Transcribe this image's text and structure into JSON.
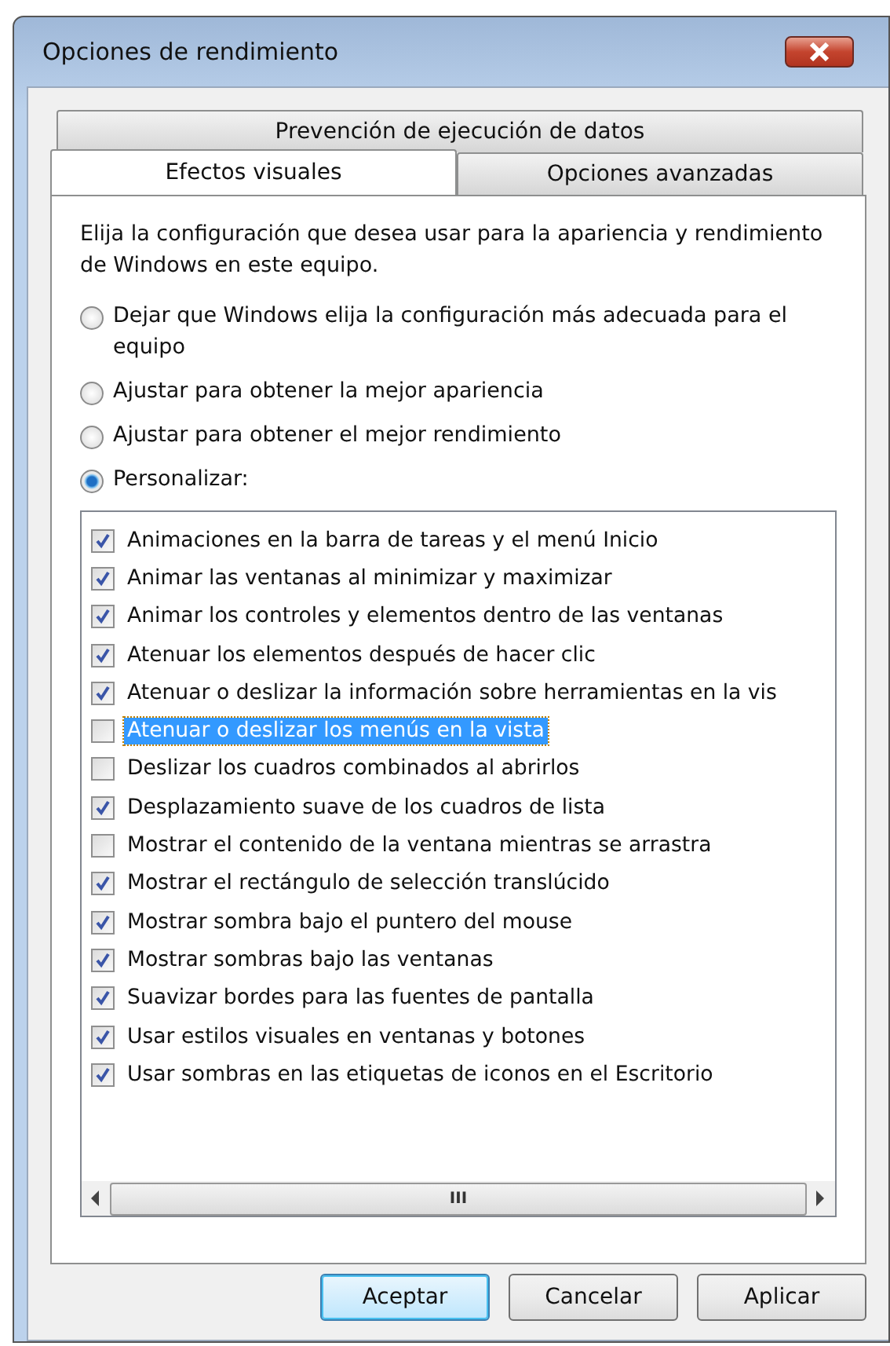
{
  "window": {
    "title": "Opciones de rendimiento"
  },
  "tabs_back": [
    {
      "label": "Prevención de ejecución de datos",
      "selected": false
    }
  ],
  "tabs_front": [
    {
      "label": "Efectos visuales",
      "selected": true
    },
    {
      "label": "Opciones avanzadas",
      "selected": false
    }
  ],
  "intro": "Elija la configuración que desea usar para la apariencia y rendimiento de Windows en este equipo.",
  "options": [
    {
      "label": "Dejar que Windows elija la configuración más adecuada para el equipo",
      "selected": false
    },
    {
      "label": "Ajustar para obtener la mejor apariencia",
      "selected": false
    },
    {
      "label": "Ajustar para obtener el mejor rendimiento",
      "selected": false
    },
    {
      "label": "Personalizar:",
      "selected": true
    }
  ],
  "effects": [
    {
      "label": "Animaciones en la barra de tareas y el menú Inicio",
      "checked": true,
      "selected": false
    },
    {
      "label": "Animar las ventanas al minimizar y maximizar",
      "checked": true,
      "selected": false
    },
    {
      "label": "Animar los controles y elementos dentro de las ventanas",
      "checked": true,
      "selected": false
    },
    {
      "label": "Atenuar los elementos después de hacer clic",
      "checked": true,
      "selected": false
    },
    {
      "label": "Atenuar o deslizar la información sobre herramientas en la vis",
      "checked": true,
      "selected": false
    },
    {
      "label": "Atenuar o deslizar los menús en la vista",
      "checked": false,
      "selected": true
    },
    {
      "label": "Deslizar los cuadros combinados al abrirlos",
      "checked": false,
      "selected": false
    },
    {
      "label": "Desplazamiento suave de los cuadros de lista",
      "checked": true,
      "selected": false
    },
    {
      "label": "Mostrar el contenido de la ventana mientras se arrastra",
      "checked": false,
      "selected": false
    },
    {
      "label": "Mostrar el rectángulo de selección translúcido",
      "checked": true,
      "selected": false
    },
    {
      "label": "Mostrar sombra bajo el puntero del mouse",
      "checked": true,
      "selected": false
    },
    {
      "label": "Mostrar sombras bajo las ventanas",
      "checked": true,
      "selected": false
    },
    {
      "label": "Suavizar bordes para las fuentes de pantalla",
      "checked": true,
      "selected": false
    },
    {
      "label": "Usar estilos visuales en ventanas y botones",
      "checked": true,
      "selected": false
    },
    {
      "label": "Usar sombras en las etiquetas de iconos en el Escritorio",
      "checked": true,
      "selected": false
    }
  ],
  "scrollbar": {
    "grip": "III"
  },
  "buttons": [
    {
      "label": "Aceptar",
      "default": true
    },
    {
      "label": "Cancelar",
      "default": false
    },
    {
      "label": "Aplicar",
      "default": false
    }
  ]
}
